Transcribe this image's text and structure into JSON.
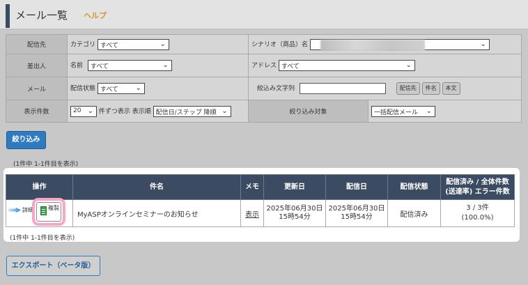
{
  "header": {
    "title": "メール一覧",
    "help": "ヘルプ"
  },
  "filter": {
    "delivery_to": "配信先",
    "category_label": "カテゴリ",
    "category_value": "すべて",
    "scenario_label": "シナリオ（商品）名",
    "sender": "差出人",
    "name_label": "名前",
    "name_value": "すべて",
    "address_label": "アドレス",
    "address_value": "すべて",
    "mail": "メール",
    "status_label": "配信状態",
    "status_value": "すべて",
    "search_label": "絞込み文字列",
    "btn_dest": "配信先",
    "btn_subject": "件名",
    "btn_body": "本文",
    "count_label": "表示件数",
    "count_value": "20",
    "per": "件ずつ表示",
    "order_label": "表示順",
    "order_value": "配信日/ステップ 降順",
    "target_label": "絞り込み対象",
    "target_value": "一括配信メール"
  },
  "narrow_button": "絞り込み",
  "count_top": "(1件中 1-1件目を表示)",
  "count_bottom": "(1件中 1-1件目を表示)",
  "table": {
    "headers": [
      "操作",
      "件名",
      "メモ",
      "更新日",
      "配信日",
      "配信状態"
    ],
    "header_last_line1": "配信済み / 全体件数",
    "header_last_line2": "(送達率) エラー件数",
    "row": {
      "detail": "詳細",
      "copy": "複製",
      "subject": "MyASPオンラインセミナーのお知らせ",
      "memo": "表示",
      "updated_date": "2025年06月30日",
      "updated_time": "15時54分",
      "sent_date": "2025年06月30日",
      "sent_time": "15時54分",
      "status": "配信済み",
      "count": "3 / 3件",
      "rate": "(100.0%)"
    }
  },
  "export_button": "エクスポート（ベータ版）"
}
